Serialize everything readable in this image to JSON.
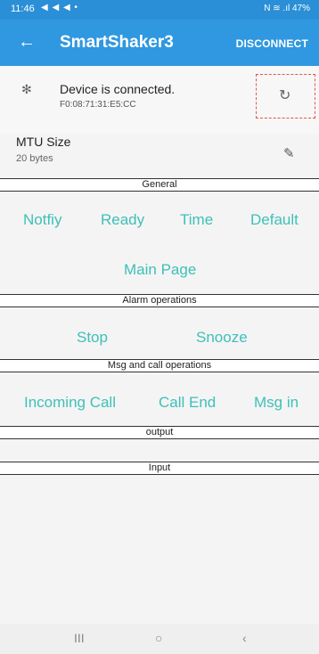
{
  "status_bar": {
    "time": "11:46",
    "notif_icons": "◀ ◀ ◀ •",
    "right": "N ≋ .ıl 47%"
  },
  "app_bar": {
    "back_icon": "←",
    "title": "SmartShaker3",
    "disconnect": "DISCONNECT"
  },
  "connection": {
    "bt_icon": "✻",
    "status": "Device is connected.",
    "mac": "F0:08:71:31:E5:CC",
    "refresh_icon": "↻"
  },
  "mtu": {
    "label": "MTU Size",
    "value": "20 bytes",
    "edit_icon": "✎"
  },
  "sections": {
    "general": "General",
    "alarm": "Alarm operations",
    "msg_call": "Msg and call operations",
    "output": "output",
    "input": "Input"
  },
  "buttons": {
    "notify": "Notfiy",
    "ready": "Ready",
    "time": "Time",
    "default": "Default",
    "main_page": "Main Page",
    "stop": "Stop",
    "snooze": "Snooze",
    "incoming_call": "Incoming Call",
    "call_end": "Call End",
    "msg_in": "Msg in"
  },
  "nav": {
    "recents": "III",
    "home": "○",
    "back": "‹"
  },
  "colors": {
    "app_bar": "#2f98e0",
    "accent": "#3ec0b8",
    "highlight": "#e0564a"
  }
}
